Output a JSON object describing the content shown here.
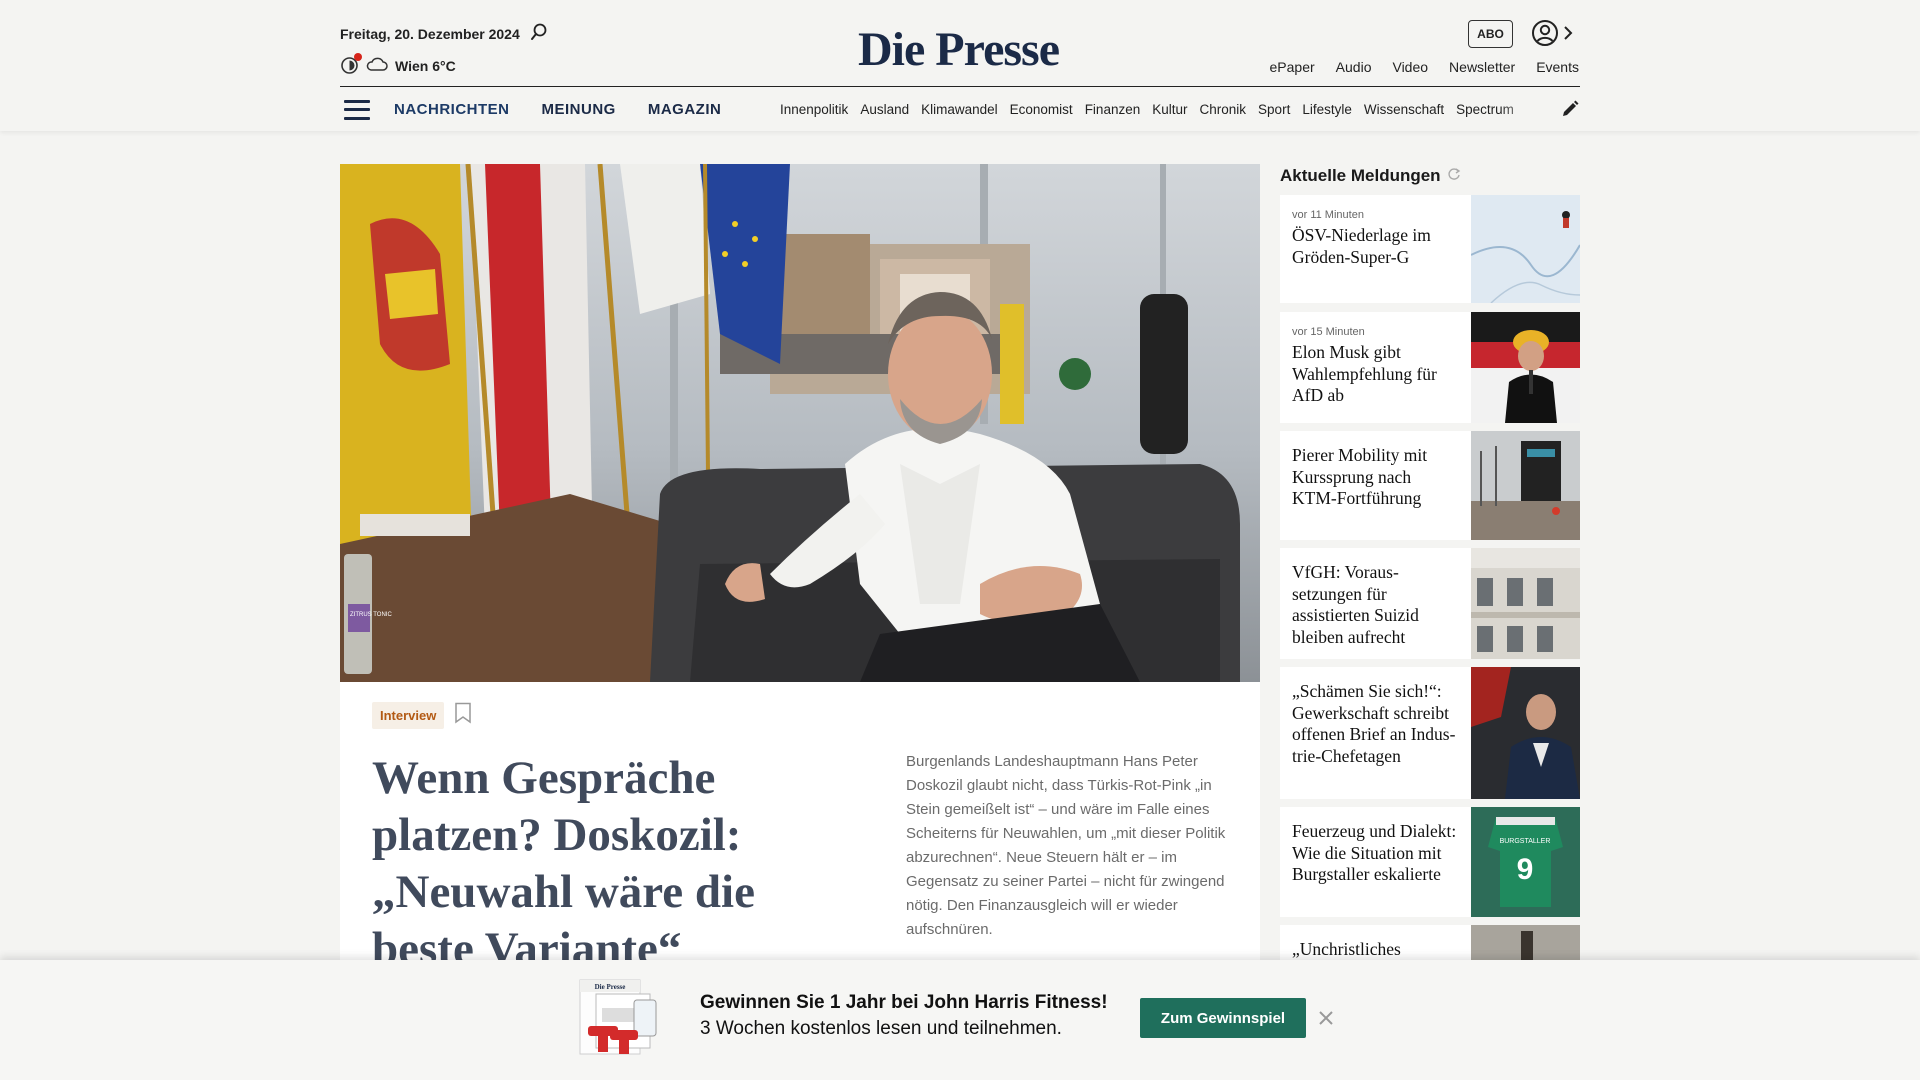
{
  "header": {
    "date": "Freitag, 20. Dezember 2024",
    "weather": "Wien 6°C",
    "logo": "Die Presse",
    "abo": "ABO",
    "top_links": [
      "ePaper",
      "Audio",
      "Video",
      "Newsletter",
      "Events"
    ],
    "main_nav": [
      "NACHRICHTEN",
      "MEINUNG",
      "MAGAZIN"
    ],
    "sub_nav": [
      "Innenpolitik",
      "Ausland",
      "Klimawandel",
      "Economist",
      "Finanzen",
      "Kultur",
      "Chronik",
      "Sport",
      "Lifestyle",
      "Wissenschaft",
      "Spectrum"
    ]
  },
  "hero": {
    "tag": "Interview",
    "headline": "Wenn Gespräche platzen? Doskozil: „Neuwahl wäre die beste Variante“",
    "lead": "Burgenlands Landeshauptmann Hans Peter Doskozil glaubt nicht, dass Türkis-Rot-Pink „in Stein gemeißelt ist“ – und wäre im Falle eines Scheiterns für Neuwahlen, um „mit dieser Politik abzurechnen“. Neue Steuern hält er – im Gegensatz zu seiner Partei – nicht für zwingend nötig. Den Finanzausgleich will er wieder aufschnüren.",
    "bottle_label": "ZITRUS TONIC"
  },
  "sidebar": {
    "title": "Aktuelle Meldungen",
    "items": [
      {
        "time": "vor 11 Minuten",
        "title": "ÖSV-Niederlage im Gröden-Super-G"
      },
      {
        "time": "vor 15 Minuten",
        "title": "Elon Musk gibt Wahlempfehlung für AfD ab"
      },
      {
        "time": "",
        "title": "Pierer Mobility mit Kurssprung nach KTM-Fortführung"
      },
      {
        "time": "",
        "title": "VfGH: Voraus-setzungen für assistierten Suizid bleiben aufrecht"
      },
      {
        "time": "",
        "title": "„Schämen Sie sich!“: Gewerkschaft schreibt offenen Brief an Indus-trie-Chefetagen"
      },
      {
        "time": "",
        "title": "Feuerzeug und Dialekt: Wie die Situation mit Burgstaller eskalierte"
      },
      {
        "time": "",
        "title": "„Unchristliches"
      }
    ],
    "jersey_number": "9",
    "jersey_name": "BURGSTALLER"
  },
  "promo": {
    "line1": "Gewinnen Sie 1 Jahr bei John Harris Fitness!",
    "line2": "3 Wochen kostenlos lesen und teilnehmen.",
    "button": "Zum Gewinnspiel",
    "mini_logo": "Die Presse"
  },
  "colors": {
    "brand_navy": "#1b2a47",
    "tag_orange": "#b35a14",
    "cta_green": "#1f6f5c",
    "alert_red": "#d6241a"
  },
  "icons": [
    "search-icon",
    "moon-icon",
    "cloud-icon",
    "user-icon",
    "chevron-right-icon",
    "menu-icon",
    "pencil-icon",
    "bookmark-icon",
    "refresh-icon",
    "close-icon"
  ]
}
